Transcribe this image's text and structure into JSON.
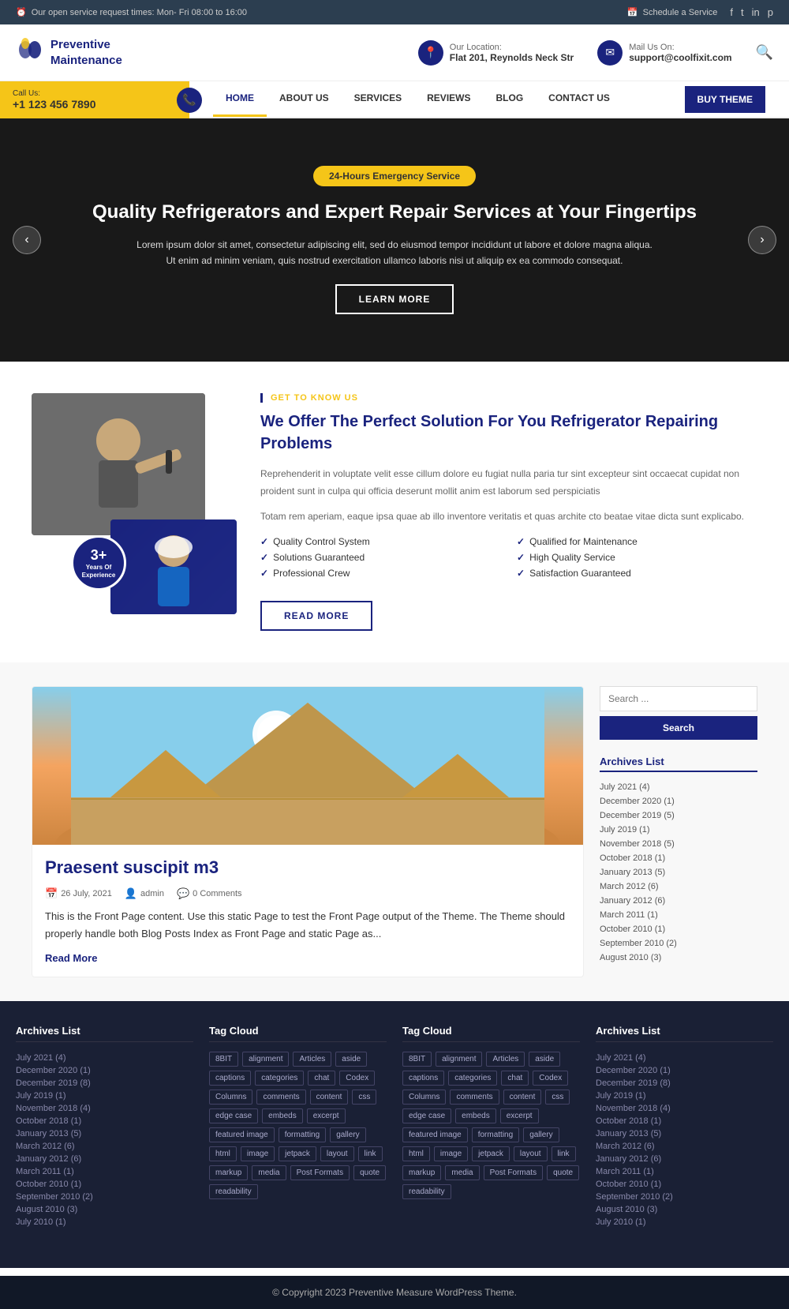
{
  "topBar": {
    "serviceTime": "Our open service request times: Mon- Fri 08:00 to 16:00",
    "scheduleService": "Schedule a Service",
    "clockIcon": "⏰",
    "calendarIcon": "📅"
  },
  "header": {
    "logoLine1": "Preventive",
    "logoLine2": "Maintenance",
    "location_label": "Our Location:",
    "location_value": "Flat 201, Reynolds Neck Str",
    "mail_label": "Mail Us On:",
    "mail_value": "support@coolfixit.com"
  },
  "callSection": {
    "callUs": "Call Us:",
    "phone": "+1 123 456 7890"
  },
  "nav": {
    "items": [
      "HOME",
      "ABOUT US",
      "SERVICES",
      "REVIEWS",
      "BLOG",
      "CONTACT US",
      "BUY THEME"
    ],
    "active": "HOME"
  },
  "hero": {
    "badge": "24-Hours Emergency Service",
    "title": "Quality Refrigerators and Expert Repair Services at Your Fingertips",
    "description": "Lorem ipsum dolor sit amet, consectetur adipiscing elit, sed do eiusmod tempor incididunt ut labore et dolore magna aliqua. Ut enim ad minim veniam, quis nostrud exercitation ullamco laboris nisi ut aliquip ex ea commodo consequat.",
    "learnMore": "LEARN MORE",
    "prevArrow": "‹",
    "nextArrow": "›"
  },
  "about": {
    "sectionLabel": "GET TO KNOW US",
    "title": "We Offer The Perfect Solution For You Refrigerator Repairing Problems",
    "desc1": "Reprehenderit in voluptate velit esse cillum dolore eu fugiat nulla paria tur sint excepteur sint occaecat cupidat non proident sunt in culpa qui officia deserunt mollit anim est laborum sed perspiciatis",
    "desc2": "Totam rem aperiam, eaque ipsa quae ab illo inventore veritatis et quas archite cto beatae vitae dicta sunt explicabo.",
    "checklist": [
      "Quality Control System",
      "Qualified for Maintenance",
      "Solutions Guaranteed",
      "High Quality Service",
      "Professional Crew",
      "Satisfaction Guaranteed"
    ],
    "readMore": "READ MORE",
    "yearsNum": "3+",
    "yearsText": "Years Of Experience"
  },
  "blog": {
    "title": "Praesent suscipit m3",
    "date": "26 July, 2021",
    "author": "admin",
    "comments": "0 Comments",
    "excerpt": "This is the Front Page content. Use this static Page to test the Front Page output of the Theme. The Theme should properly handle both Blog Posts Index as Front Page and static Page as...",
    "readMore": "Read More"
  },
  "sidebar": {
    "searchPlaceholder": "Search ...",
    "searchBtn": "Search",
    "archivesTitle": "Archives List",
    "archives": [
      "July 2021 (4)",
      "December 2020 (1)",
      "December 2019 (5)",
      "July 2019 (1)",
      "November 2018 (5)",
      "October 2018 (1)",
      "January 2013 (5)",
      "March 2012 (6)",
      "January 2012 (6)",
      "March 2011 (1)",
      "October 2010 (1)",
      "September 2010 (2)",
      "August 2010 (3)"
    ]
  },
  "footer": {
    "col1_title": "Archives List",
    "col1_items": [
      "July 2021 (4)",
      "December 2020 (1)",
      "December 2019 (8)",
      "July 2019 (1)",
      "November 2018 (4)",
      "October 2018 (1)",
      "January 2013 (5)",
      "March 2012 (6)",
      "January 2012 (6)",
      "March 2011 (1)",
      "October 2010 (1)",
      "September 2010 (2)",
      "August 2010 (3)",
      "July 2010 (1)"
    ],
    "col2_title": "Tag Cloud",
    "col2_tags": [
      "8BIT",
      "alignment",
      "Articles",
      "aside",
      "captions",
      "categories",
      "chat",
      "Codex",
      "Columns",
      "comments",
      "content",
      "css",
      "edge case",
      "embeds",
      "excerpt",
      "featured image",
      "formatting",
      "gallery",
      "html",
      "image",
      "jetpack",
      "layout",
      "link",
      "markup",
      "media",
      "Post Formats",
      "quote",
      "readability"
    ],
    "col3_title": "Tag Cloud",
    "col3_tags": [
      "8BIT",
      "alignment",
      "Articles",
      "aside",
      "captions",
      "categories",
      "chat",
      "Codex",
      "Columns",
      "comments",
      "content",
      "css",
      "edge case",
      "embeds",
      "excerpt",
      "featured image",
      "formatting",
      "gallery",
      "html",
      "image",
      "jetpack",
      "layout",
      "link",
      "markup",
      "media",
      "Post Formats",
      "quote",
      "readability"
    ],
    "col4_title": "Archives List",
    "col4_items": [
      "July 2021 (4)",
      "December 2020 (1)",
      "December 2019 (8)",
      "July 2019 (1)",
      "November 2018 (4)",
      "October 2018 (1)",
      "January 2013 (5)",
      "March 2012 (6)",
      "January 2012 (6)",
      "March 2011 (1)",
      "October 2010 (1)",
      "September 2010 (2)",
      "August 2010 (3)",
      "July 2010 (1)"
    ],
    "copyright": "© Copyright 2023 Preventive Measure WordPress Theme."
  }
}
